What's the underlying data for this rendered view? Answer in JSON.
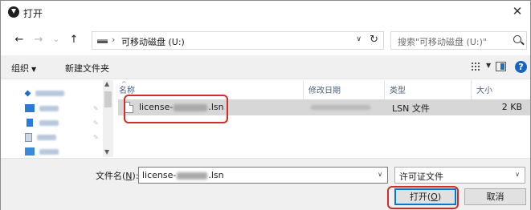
{
  "window": {
    "title": "打开",
    "close_glyph": "✕"
  },
  "nav": {
    "back_glyph": "←",
    "forward_glyph": "→",
    "recent_glyph": "⌄",
    "up_glyph": "↑"
  },
  "address": {
    "separator": "›",
    "path": "可移动磁盘 (U:)",
    "dropdown_glyph": "∨",
    "refresh_glyph": "↻"
  },
  "search": {
    "placeholder": "搜索\"可移动磁盘 (U:)\""
  },
  "toolbar": {
    "organize_label": "组织",
    "organize_caret": "▼",
    "new_folder_label": "新建文件夹",
    "view_caret": "▼",
    "help_label": "?"
  },
  "columns": {
    "name": "名称",
    "modified": "修改日期",
    "type": "类型",
    "size": "大小"
  },
  "files": [
    {
      "name_prefix": "license-",
      "name_suffix": ".lsn",
      "type": "LSN 文件",
      "size": "2 KB"
    }
  ],
  "bottom": {
    "filename_label_prefix": "文件名(",
    "filename_label_key": "N",
    "filename_label_suffix": "):",
    "filename_prefix": "license-",
    "filename_suffix": ".lsn",
    "filetype": "许可证文件",
    "open_label_prefix": "打开(",
    "open_label_key": "O",
    "open_label_suffix": ")",
    "cancel_label": "取消"
  },
  "colors": {
    "highlight": "#d52b2b",
    "selection": "#d7d7d7",
    "accent": "#0078d7"
  }
}
